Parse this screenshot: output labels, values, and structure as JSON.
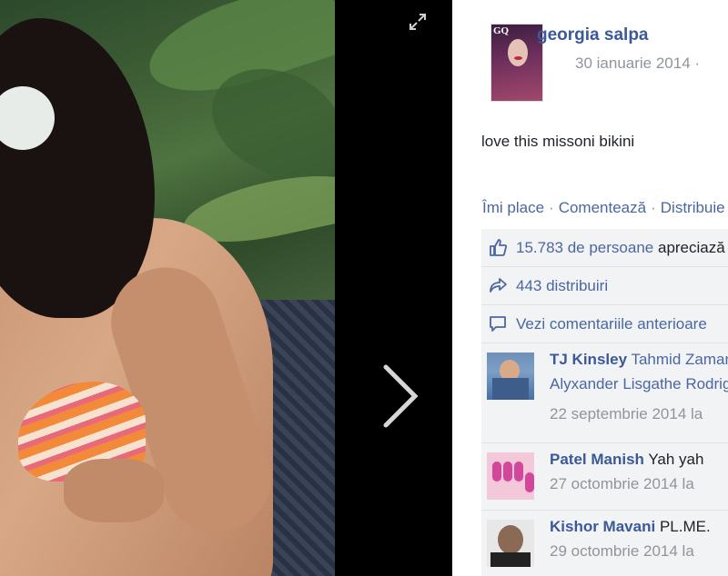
{
  "viewer": {
    "expand_icon": "expand-icon",
    "next_icon": "chevron-right-icon"
  },
  "post": {
    "author": "georgia salpa",
    "date": "30 ianuarie 2014 ·",
    "text": "love this missoni bikini"
  },
  "actions": {
    "like": "Îmi place",
    "comment": "Comentează",
    "share": "Distribuie",
    "separator": "·"
  },
  "ufi": {
    "likes_count": "15.783 de persoane",
    "likes_suffix": "apreciază asta.",
    "shares": "443 distribuiri",
    "view_previous": "Vezi comentariile anterioare"
  },
  "comments": [
    {
      "name": "TJ Kinsley",
      "text": "Tahmid Zaman",
      "text_line2": "Alyxander Lisgathe Rodriguez",
      "date": "22 septembrie 2014 la"
    },
    {
      "name": "Patel Manish",
      "text": "Yah yah",
      "date": "27 octombrie 2014 la"
    },
    {
      "name": "Kishor Mavani",
      "text": "PL.ME.",
      "date": "29 octombrie 2014 la"
    }
  ],
  "colors": {
    "link": "#3b5998",
    "action": "#4b67a1",
    "muted": "#90949c",
    "ufi_bg": "#f2f3f5"
  }
}
